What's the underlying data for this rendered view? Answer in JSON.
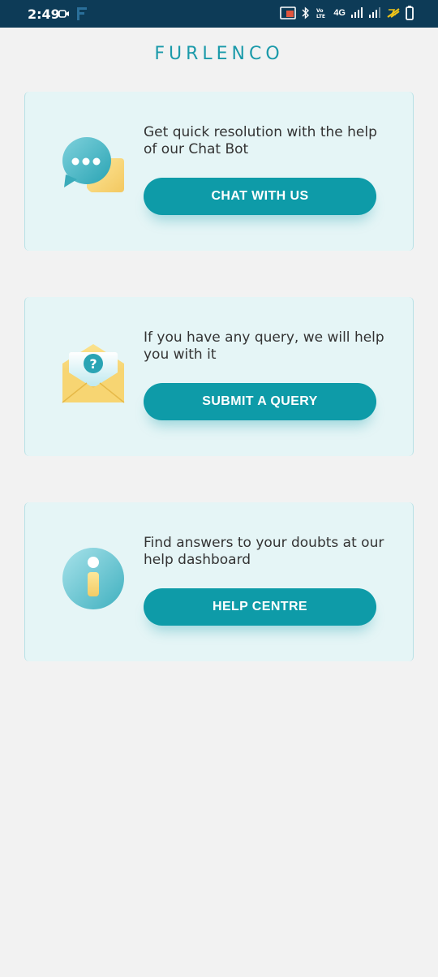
{
  "status_bar": {
    "time": "2:49",
    "network": "4G"
  },
  "brand": {
    "name": "FURLENCO",
    "accent": "#1b9aaa"
  },
  "cards": [
    {
      "description": "Get quick resolution with the help of our Chat Bot",
      "button_label": "CHAT WITH US",
      "icon": "chat-bubbles-icon"
    },
    {
      "description": "If you have any query, we will help you with it",
      "button_label": "SUBMIT A QUERY",
      "icon": "envelope-question-icon"
    },
    {
      "description": "Find answers to your doubts at our help dashboard",
      "button_label": "HELP CENTRE",
      "icon": "info-icon"
    }
  ],
  "colors": {
    "button": "#0e9ba8",
    "card_bg": "#e5f5f6",
    "page_bg": "#f2f2f2",
    "status_bar": "#0d3b57"
  }
}
